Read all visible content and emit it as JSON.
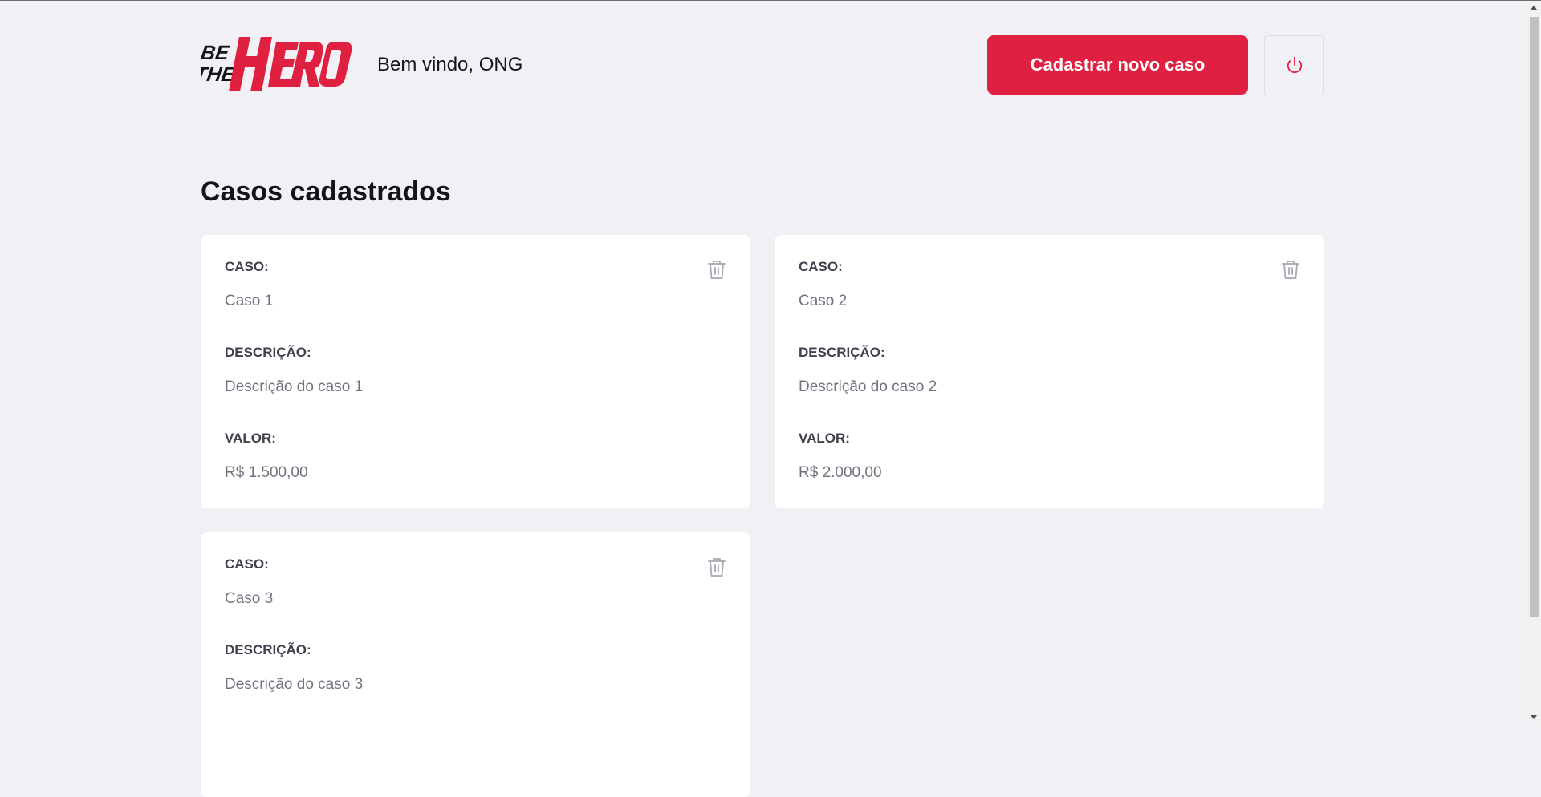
{
  "header": {
    "logo_text_small": "BE THE",
    "logo_text_big": "HERO",
    "welcome": "Bem vindo, ONG",
    "new_case_label": "Cadastrar novo caso",
    "logout_icon": "power-icon"
  },
  "main": {
    "title": "Casos cadastrados",
    "cards": [
      {
        "case_label": "CASO:",
        "case_value": "Caso 1",
        "description_label": "DESCRIÇÃO:",
        "description_value": "Descrição do caso 1",
        "value_label": "VALOR:",
        "value_value": "R$ 1.500,00"
      },
      {
        "case_label": "CASO:",
        "case_value": "Caso 2",
        "description_label": "DESCRIÇÃO:",
        "description_value": "Descrição do caso 2",
        "value_label": "VALOR:",
        "value_value": "R$ 2.000,00"
      },
      {
        "case_label": "CASO:",
        "case_value": "Caso 3",
        "description_label": "DESCRIÇÃO:",
        "description_value": "Descrição do caso 3"
      }
    ]
  },
  "colors": {
    "brand": "#e02041",
    "background": "#f0f0f5",
    "card": "#ffffff",
    "label": "#41414d",
    "value": "#737380"
  }
}
